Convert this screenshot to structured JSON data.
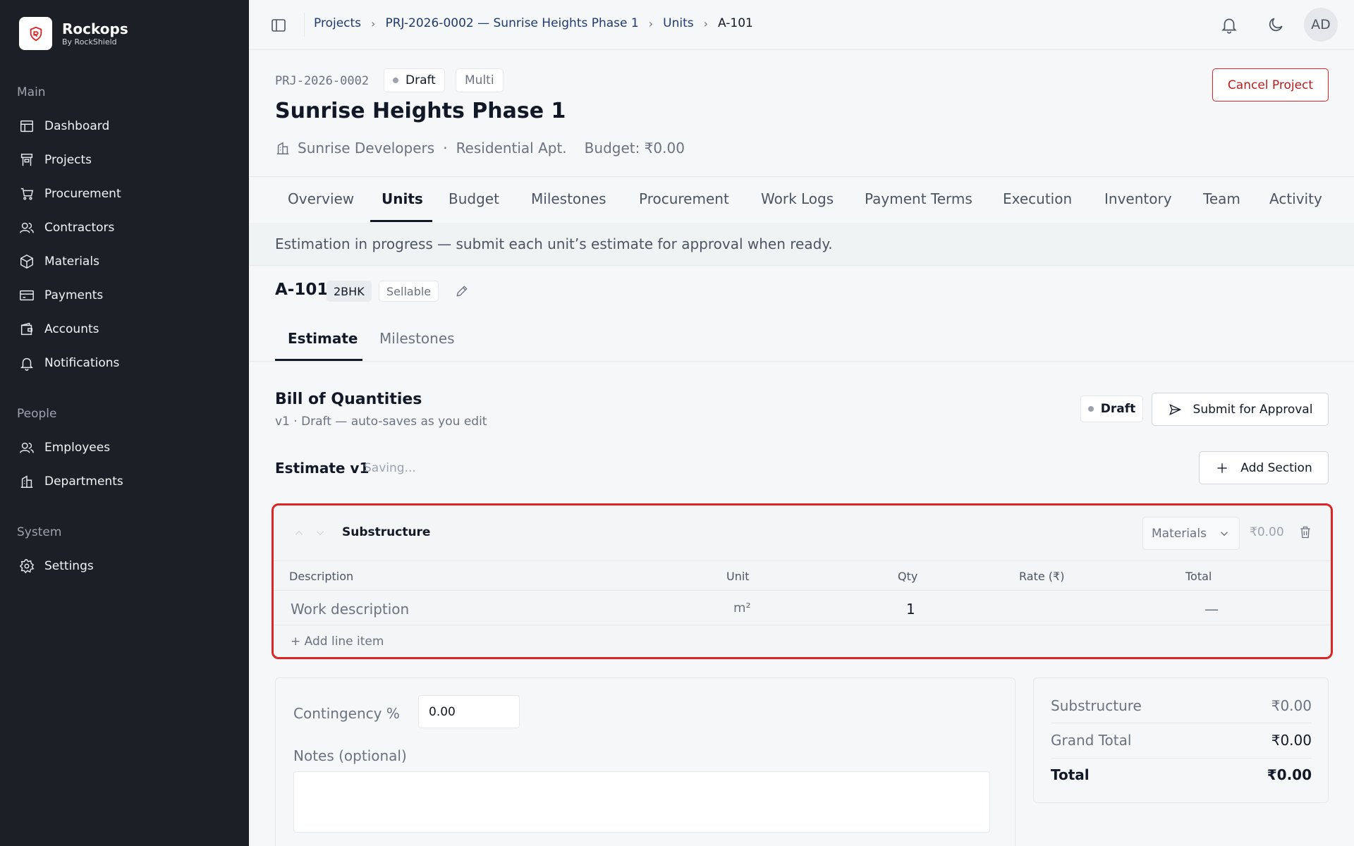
{
  "brand": {
    "name": "Rockops",
    "sub": "By RockShield"
  },
  "sidebar": {
    "sections": [
      {
        "label": "Main",
        "items": [
          "Dashboard",
          "Projects",
          "Procurement",
          "Contractors",
          "Materials",
          "Payments",
          "Accounts",
          "Notifications"
        ]
      },
      {
        "label": "People",
        "items": [
          "Employees",
          "Departments"
        ]
      },
      {
        "label": "System",
        "items": [
          "Settings"
        ]
      }
    ]
  },
  "breadcrumb": [
    "Projects",
    "PRJ-2026-0002 — Sunrise Heights Phase 1",
    "Units",
    "A-101"
  ],
  "user": {
    "initials": "AD"
  },
  "project": {
    "code": "PRJ-2026-0002",
    "status": "Draft",
    "type": "Multi",
    "title": "Sunrise Heights Phase 1",
    "developer": "Sunrise Developers",
    "separator": "·",
    "category": "Residential Apt.",
    "budget": "Budget: ₹0.00",
    "cancel_label": "Cancel Project"
  },
  "tabs": [
    "Overview",
    "Units",
    "Budget",
    "Milestones",
    "Procurement",
    "Work Logs",
    "Payment Terms",
    "Execution",
    "Inventory",
    "Team",
    "Activity"
  ],
  "active_tab": "Units",
  "banner": "Estimation in progress — submit each unit’s estimate for approval when ready.",
  "unit": {
    "code": "A-101",
    "type": "2BHK",
    "tag": "Sellable"
  },
  "subtabs": [
    "Estimate",
    "Milestones"
  ],
  "boq": {
    "title": "Bill of Quantities",
    "subtitle": "v1 · Draft — auto-saves as you edit",
    "status": "Draft",
    "submit_label": "Submit for Approval",
    "estimate_title": "Estimate v1",
    "estimate_status": "Saving...",
    "add_section_label": "Add Section"
  },
  "section": {
    "name": "Substructure",
    "category": "Materials",
    "total": "₹0.00",
    "columns": [
      "Description",
      "Unit",
      "Qty",
      "Rate (₹)",
      "Total"
    ],
    "row": {
      "description": "Work description",
      "unit": "m²",
      "qty": "1",
      "rate": "",
      "total": "—"
    },
    "add_line_label": "+ Add line item"
  },
  "contingency": {
    "label": "Contingency %",
    "value": "0.00"
  },
  "notes": {
    "label": "Notes (optional)",
    "value": ""
  },
  "summary": [
    {
      "label": "Substructure",
      "value": "₹0.00"
    },
    {
      "label": "Grand Total",
      "value": "₹0.00"
    },
    {
      "label": "Total",
      "value": "₹0.00"
    }
  ]
}
